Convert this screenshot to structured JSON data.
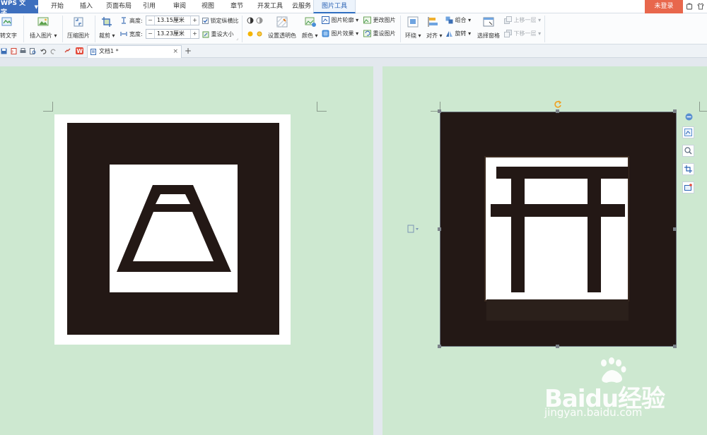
{
  "app": {
    "name": "WPS 文字"
  },
  "menu": {
    "tabs": [
      "开始",
      "插入",
      "页面布局",
      "引用",
      "审阅",
      "视图",
      "章节",
      "开发工具",
      "云服务",
      "图片工具"
    ],
    "active_tab": "图片工具",
    "login_label": "未登录"
  },
  "ribbon": {
    "wrap_text": "转文字",
    "insert_picture": "插入图片",
    "compress_picture": "压缩图片",
    "crop": "裁剪",
    "height_label": "高度:",
    "height_value": "13.15厘米",
    "width_label": "宽度:",
    "width_value": "13.23厘米",
    "lock_ratio": "锁定纵横比",
    "reset_size": "重设大小",
    "set_transparent": "设置透明色",
    "color": "颜色",
    "picture_outline": "图片轮廓",
    "picture_effects": "图片效果",
    "change_picture": "更改图片",
    "reset_picture": "重设图片",
    "wrap": "环绕",
    "align": "对齐",
    "group": "组合",
    "rotate": "旋转",
    "selection_pane": "选择窗格",
    "bring_forward": "上移一层",
    "send_backward": "下移一层",
    "minus": "−",
    "plus": "+"
  },
  "document": {
    "tab_name": "文档1 *",
    "close": "×",
    "new_tab": "+"
  },
  "watermark": {
    "brand": "Baidu经验",
    "url": "jingyan.baidu.com"
  },
  "colors": {
    "page_bg": "#cde8d0",
    "accent": "#3d6fbe",
    "login": "#e8674c",
    "icon_dark": "#231815"
  }
}
